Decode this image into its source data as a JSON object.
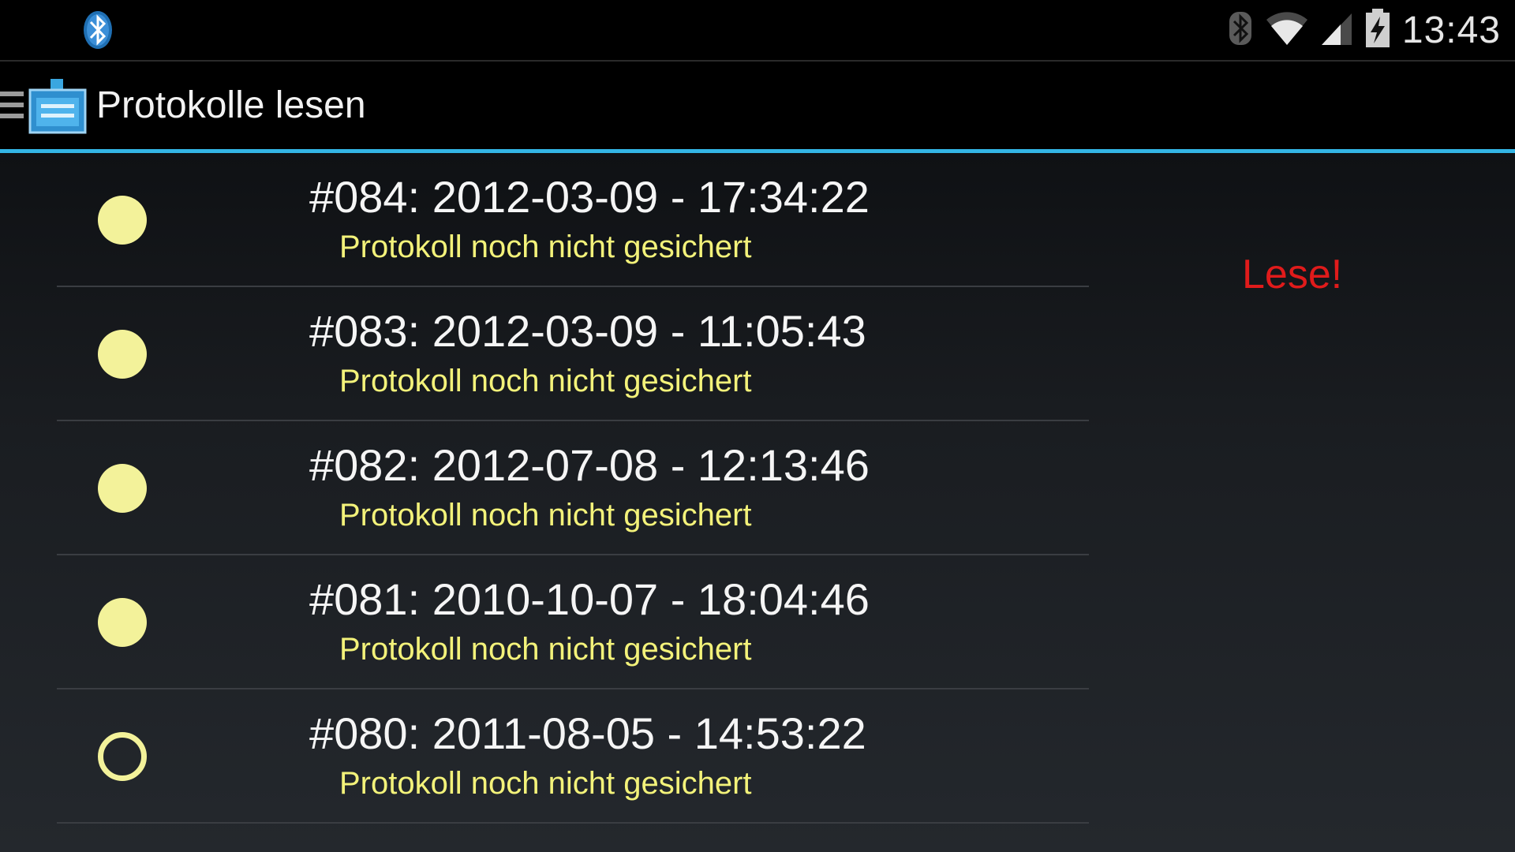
{
  "statusbar": {
    "notification_icon": "bluetooth-icon",
    "icons": [
      "bluetooth-icon",
      "wifi-icon",
      "signal-icon",
      "battery-charging-icon"
    ],
    "time": "13:43"
  },
  "actionbar": {
    "drawer_icon": "menu-icon",
    "app_icon": "protocol-reader-icon",
    "title": "Protokolle lesen"
  },
  "colors": {
    "accent": "#33b5e5",
    "dot": "#f3f29a",
    "secondary_text": "#f3f27a",
    "alert": "#e01b1b"
  },
  "protocols": [
    {
      "primary": "#084: 2012-03-09 - 17:34:22",
      "secondary": "Protokoll noch nicht gesichert",
      "selected": true
    },
    {
      "primary": "#083: 2012-03-09 - 11:05:43",
      "secondary": "Protokoll noch nicht gesichert",
      "selected": true
    },
    {
      "primary": "#082: 2012-07-08 - 12:13:46",
      "secondary": "Protokoll noch nicht gesichert",
      "selected": true
    },
    {
      "primary": "#081: 2010-10-07 - 18:04:46",
      "secondary": "Protokoll noch nicht gesichert",
      "selected": true
    },
    {
      "primary": "#080: 2011-08-05 - 14:53:22",
      "secondary": "Protokoll noch nicht gesichert",
      "selected": false
    }
  ],
  "status_label": "Lese!"
}
